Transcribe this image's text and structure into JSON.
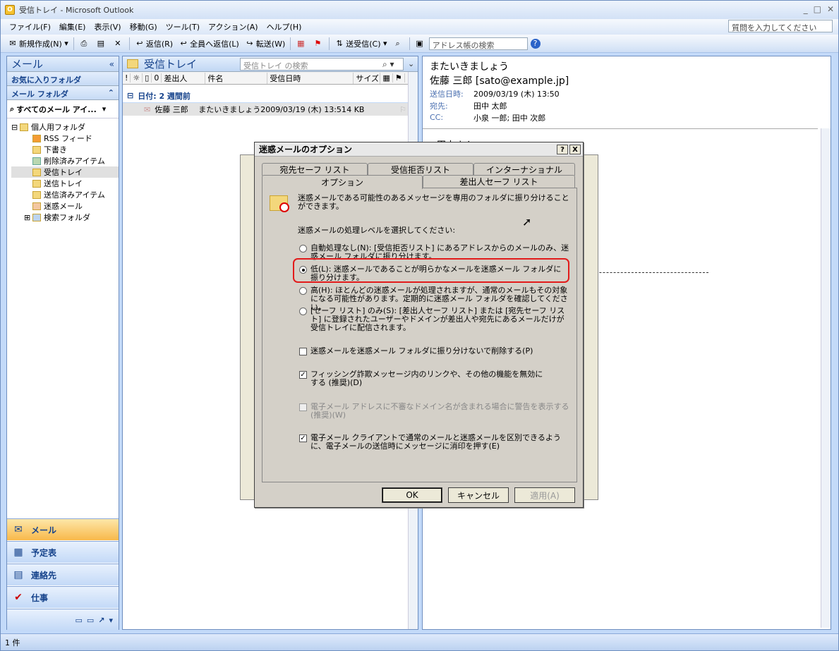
{
  "window": {
    "title": "受信トレイ - Microsoft Outlook",
    "min": "_",
    "max": "□",
    "close": "✕"
  },
  "menu": [
    "ファイル(F)",
    "編集(E)",
    "表示(V)",
    "移動(G)",
    "ツール(T)",
    "アクション(A)",
    "ヘルプ(H)"
  ],
  "help_search_placeholder": "質問を入力してください",
  "toolbar": {
    "new": "新規作成(N)",
    "reply": "返信(R)",
    "reply_all": "全員へ返信(L)",
    "forward": "転送(W)",
    "send_receive": "送受信(C)",
    "address_search": "アドレス帳の検索"
  },
  "nav": {
    "title": "メール",
    "favorites": "お気に入りフォルダ",
    "mail_folders": "メール フォルダ",
    "all_mail": "すべてのメール アイ...",
    "folders": [
      {
        "label": "個人用フォルダ",
        "level": 0
      },
      {
        "label": "RSS フィード",
        "level": 1
      },
      {
        "label": "下書き",
        "level": 1
      },
      {
        "label": "削除済みアイテム",
        "level": 1
      },
      {
        "label": "受信トレイ",
        "level": 1,
        "selected": true
      },
      {
        "label": "送信トレイ",
        "level": 1
      },
      {
        "label": "送信済みアイテム",
        "level": 1
      },
      {
        "label": "迷惑メール",
        "level": 1
      },
      {
        "label": "検索フォルダ",
        "level": 1
      }
    ],
    "buttons": [
      "メール",
      "予定表",
      "連絡先",
      "仕事"
    ]
  },
  "inbox": {
    "title": "受信トレイ",
    "search_placeholder": "受信トレイ の検索",
    "columns": {
      "from": "差出人",
      "subject": "件名",
      "received": "受信日時",
      "size": "サイズ"
    },
    "group": "日付: 2 週間前",
    "rows": [
      {
        "from": "佐藤 三郎",
        "subject": "またいきましょう",
        "received": "2009/03/19 (木) 13:51",
        "size": "4 KB"
      }
    ]
  },
  "reading": {
    "subject": "またいきましょう",
    "from": "佐藤 三郎 [sato@example.jp]",
    "sent_label": "送信日時:",
    "sent": "2009/03/19 (木) 13:50",
    "to_label": "宛先:",
    "to": "田中 太郎",
    "cc_label": "CC:",
    "cc": "小泉 一郎; 田中 次郎",
    "body_partial": "田中さん"
  },
  "status": "1 件",
  "dialog": {
    "title": "迷惑メールのオプション",
    "help": "?",
    "close": "X",
    "tabs_back": [
      "宛先セーフ リスト",
      "受信拒否リスト",
      "インターナショナル"
    ],
    "tabs_front": [
      "オプション",
      "差出人セーフ リスト"
    ],
    "intro": "迷惑メールである可能性のあるメッセージを専用のフォルダに振り分けることができます。",
    "level_prompt": "迷惑メールの処理レベルを選択してください:",
    "radios": [
      {
        "label": "自動処理なし(N): [受信拒否リスト] にあるアドレスからのメールのみ、迷惑メール フォルダに振り分けます。",
        "checked": false
      },
      {
        "label": "低(L): 迷惑メールであることが明らかなメールを迷惑メール フォルダに振り分けます。",
        "checked": true
      },
      {
        "label": "高(H): ほとんどの迷惑メールが処理されますが、通常のメールもその対象になる可能性があります。定期的に迷惑メール フォルダを確認してください。",
        "checked": false
      },
      {
        "label": "[セーフ リスト] のみ(S): [差出人セーフ リスト] または [宛先セーフ リスト] に登録されたユーザーやドメインが差出人や宛先にあるメールだけが受信トレイに配信されます。",
        "checked": false
      }
    ],
    "checks": [
      {
        "label": "迷惑メールを迷惑メール フォルダに振り分けないで削除する(P)",
        "checked": false,
        "disabled": false
      },
      {
        "label": "フィッシング詐欺メッセージ内のリンクや、その他の機能を無効にする (推奨)(D)",
        "checked": true,
        "disabled": false
      },
      {
        "label": "電子メール アドレスに不審なドメイン名が含まれる場合に警告を表示する (推奨)(W)",
        "checked": false,
        "disabled": true
      },
      {
        "label": "電子メール クライアントで通常のメールと迷惑メールを区別できるように、電子メールの送信時にメッセージに消印を押す(E)",
        "checked": true,
        "disabled": false
      }
    ],
    "ok": "OK",
    "cancel": "キャンセル",
    "apply": "適用(A)"
  },
  "colors": {
    "accent": "#15428b",
    "highlight": "#e21b1b",
    "active_nav": "#f8b84a"
  }
}
